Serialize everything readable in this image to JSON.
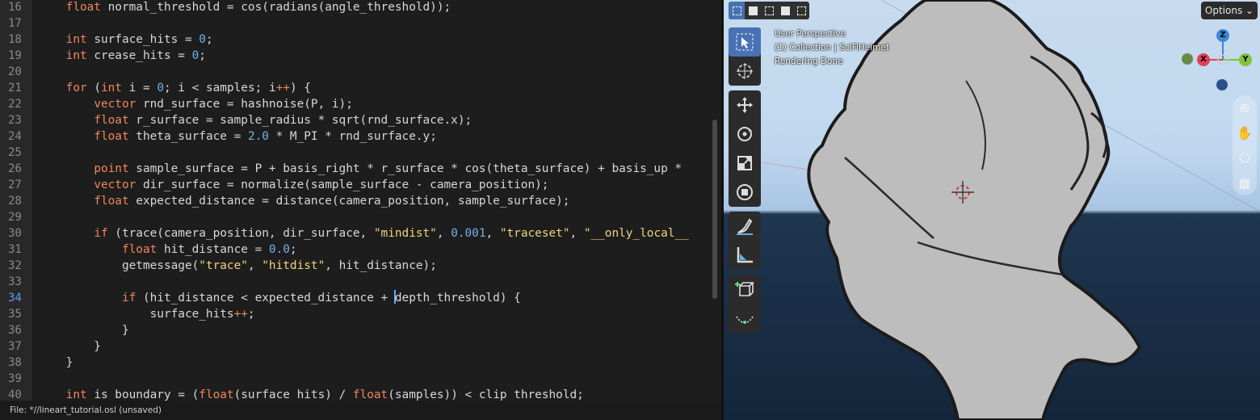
{
  "editor": {
    "lines": [
      {
        "n": "16",
        "tokens": [
          [
            "    ",
            ""
          ],
          [
            "float",
            "kw"
          ],
          [
            " normal_threshold = cos(radians(angle_threshold));",
            ""
          ]
        ]
      },
      {
        "n": "17",
        "tokens": []
      },
      {
        "n": "18",
        "tokens": [
          [
            "    ",
            ""
          ],
          [
            "int",
            "kw"
          ],
          [
            " surface_hits = ",
            ""
          ],
          [
            "0",
            "num"
          ],
          [
            ";",
            ""
          ]
        ]
      },
      {
        "n": "19",
        "tokens": [
          [
            "    ",
            ""
          ],
          [
            "int",
            "kw"
          ],
          [
            " crease_hits = ",
            ""
          ],
          [
            "0",
            "num"
          ],
          [
            ";",
            ""
          ]
        ]
      },
      {
        "n": "20",
        "tokens": []
      },
      {
        "n": "21",
        "tokens": [
          [
            "    ",
            ""
          ],
          [
            "for",
            "kw"
          ],
          [
            " (",
            ""
          ],
          [
            "int",
            "kw"
          ],
          [
            " i = ",
            ""
          ],
          [
            "0",
            "num"
          ],
          [
            "; i < samples; i",
            ""
          ],
          [
            "++",
            "kw"
          ],
          [
            ") {",
            ""
          ]
        ]
      },
      {
        "n": "22",
        "tokens": [
          [
            "        ",
            ""
          ],
          [
            "vector",
            "kw"
          ],
          [
            " rnd_surface = hashnoise(P, i);",
            ""
          ]
        ]
      },
      {
        "n": "23",
        "tokens": [
          [
            "        ",
            ""
          ],
          [
            "float",
            "kw"
          ],
          [
            " r_surface = sample_radius * sqrt(rnd_surface.x);",
            ""
          ]
        ]
      },
      {
        "n": "24",
        "tokens": [
          [
            "        ",
            ""
          ],
          [
            "float",
            "kw"
          ],
          [
            " theta_surface = ",
            ""
          ],
          [
            "2.0",
            "num"
          ],
          [
            " * M_PI * rnd_surface.y;",
            ""
          ]
        ]
      },
      {
        "n": "25",
        "tokens": []
      },
      {
        "n": "26",
        "tokens": [
          [
            "        ",
            ""
          ],
          [
            "point",
            "kw"
          ],
          [
            " sample_surface = P + basis_right * r_surface * cos(theta_surface) + basis_up * ",
            ""
          ]
        ]
      },
      {
        "n": "27",
        "tokens": [
          [
            "        ",
            ""
          ],
          [
            "vector",
            "kw"
          ],
          [
            " dir_surface = normalize(sample_surface - camera_position);",
            ""
          ]
        ]
      },
      {
        "n": "28",
        "tokens": [
          [
            "        ",
            ""
          ],
          [
            "float",
            "kw"
          ],
          [
            " expected_distance = distance(camera_position, sample_surface);",
            ""
          ]
        ]
      },
      {
        "n": "29",
        "tokens": []
      },
      {
        "n": "30",
        "tokens": [
          [
            "        ",
            ""
          ],
          [
            "if",
            "kw"
          ],
          [
            " (trace(camera_position, dir_surface, ",
            ""
          ],
          [
            "\"mindist\"",
            "str"
          ],
          [
            ", ",
            ""
          ],
          [
            "0.001",
            "num"
          ],
          [
            ", ",
            ""
          ],
          [
            "\"traceset\"",
            "str"
          ],
          [
            ", ",
            ""
          ],
          [
            "\"__only_local__",
            "str"
          ]
        ]
      },
      {
        "n": "31",
        "tokens": [
          [
            "            ",
            ""
          ],
          [
            "float",
            "kw"
          ],
          [
            " hit_distance = ",
            ""
          ],
          [
            "0.0",
            "num"
          ],
          [
            ";",
            ""
          ]
        ]
      },
      {
        "n": "32",
        "tokens": [
          [
            "            getmessage(",
            ""
          ],
          [
            "\"trace\"",
            "str"
          ],
          [
            ", ",
            ""
          ],
          [
            "\"hitdist\"",
            "str"
          ],
          [
            ", hit_distance);",
            ""
          ]
        ]
      },
      {
        "n": "33",
        "tokens": []
      },
      {
        "n": "34",
        "tokens": [
          [
            "            ",
            ""
          ],
          [
            "if",
            "kw"
          ],
          [
            " (hit_distance < expected_distance + ",
            ""
          ],
          [
            "|caret|",
            "caret"
          ],
          [
            "depth_threshold) {",
            ""
          ]
        ],
        "current": true
      },
      {
        "n": "35",
        "tokens": [
          [
            "                surface_hits",
            ""
          ],
          [
            "++",
            "kw"
          ],
          [
            ";",
            ""
          ]
        ]
      },
      {
        "n": "36",
        "tokens": [
          [
            "            }",
            ""
          ]
        ]
      },
      {
        "n": "37",
        "tokens": [
          [
            "        }",
            ""
          ]
        ]
      },
      {
        "n": "38",
        "tokens": [
          [
            "    }",
            ""
          ]
        ]
      },
      {
        "n": "39",
        "tokens": []
      },
      {
        "n": "40",
        "tokens": [
          [
            "    ",
            ""
          ],
          [
            "int",
            "kw"
          ],
          [
            " is_boundary = (",
            ""
          ],
          [
            "float",
            "kw"
          ],
          [
            "(surface_hits) / ",
            ""
          ],
          [
            "float",
            "kw"
          ],
          [
            "(samples)) < clip_threshold;",
            ""
          ]
        ]
      }
    ],
    "status": "File: *//lineart_tutorial.osl (unsaved)",
    "colors": {
      "keyword": "#f2865a",
      "string": "#f2d37b",
      "number": "#72b2e8",
      "text": "#d8d8d8"
    }
  },
  "viewport": {
    "options_label": "Options ⌄",
    "overlay_lines": [
      "User Perspective",
      "(1) Collection | SciFiHelmet",
      "Rendering Done"
    ],
    "tools": [
      {
        "name": "select-box-tool",
        "icon": "cursor-icon",
        "active": true
      },
      {
        "name": "cursor-tool",
        "icon": "3d-cursor-icon"
      },
      {
        "name": "move-tool",
        "icon": "move-icon"
      },
      {
        "name": "rotate-tool",
        "icon": "rotate-icon"
      },
      {
        "name": "scale-tool",
        "icon": "scale-icon"
      },
      {
        "name": "transform-tool",
        "icon": "transform-icon"
      },
      {
        "name": "annotate-tool",
        "icon": "annotate-icon"
      },
      {
        "name": "measure-tool",
        "icon": "measure-icon"
      },
      {
        "name": "add-cube-tool",
        "icon": "add-cube-icon"
      },
      {
        "name": "curve-tool",
        "icon": "curve-icon"
      }
    ],
    "gizmo": {
      "z": "Z",
      "x": "X",
      "y": "Y"
    },
    "accent": "#4772b3"
  }
}
